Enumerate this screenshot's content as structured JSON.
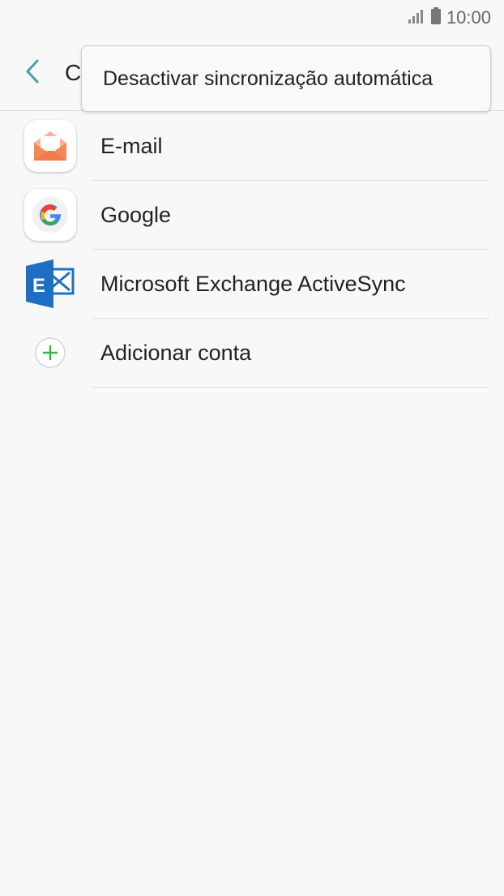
{
  "status_bar": {
    "time": "10:00"
  },
  "header": {
    "title": "C"
  },
  "overflow_menu": {
    "item": "Desactivar sincronização automática"
  },
  "accounts": [
    {
      "label": "E-mail",
      "icon": "email-icon"
    },
    {
      "label": "Google",
      "icon": "google-icon"
    },
    {
      "label": "Microsoft Exchange ActiveSync",
      "icon": "exchange-icon"
    },
    {
      "label": "Adicionar conta",
      "icon": "add-icon"
    }
  ],
  "colors": {
    "accent": "#4a9fb0",
    "add_green": "#3bb54a",
    "email_orange": "#f58a5c",
    "exchange_blue": "#1e6fc1"
  }
}
